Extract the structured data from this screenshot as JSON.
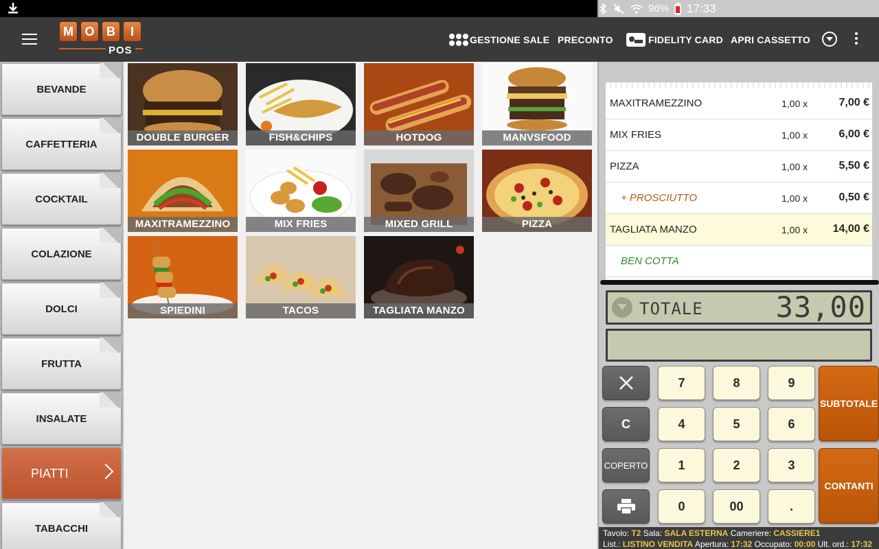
{
  "statusbar": {
    "battery": "96%",
    "time": "17:33"
  },
  "appbar": {
    "logo_letters": [
      "M",
      "O",
      "B",
      "I"
    ],
    "logo_sub": "POS",
    "actions": {
      "gestione_sale": "GESTIONE SALE",
      "preconto": "PRECONTO",
      "fidelity_card": "FIDELITY CARD",
      "apri_cassetto": "APRI CASSETTO"
    }
  },
  "categories": [
    {
      "label": "BEVANDE"
    },
    {
      "label": "CAFFETTERIA"
    },
    {
      "label": "COCKTAIL"
    },
    {
      "label": "COLAZIONE"
    },
    {
      "label": "DOLCI"
    },
    {
      "label": "FRUTTA"
    },
    {
      "label": "INSALATE"
    },
    {
      "label": "PIATTI",
      "active": true
    },
    {
      "label": "TABACCHI"
    }
  ],
  "products": [
    {
      "label": "DOUBLE BURGER",
      "color": "#6e4a2c"
    },
    {
      "label": "FISH&CHIPS",
      "color": "#c49a4c"
    },
    {
      "label": "HOTDOG",
      "color": "#c5541c"
    },
    {
      "label": "MANVSFOOD",
      "color": "#8d5b2e"
    },
    {
      "label": "MAXITRAMEZZINO",
      "color": "#b6721e"
    },
    {
      "label": "MIX FRIES",
      "color": "#d9a94a"
    },
    {
      "label": "MIXED GRILL",
      "color": "#5a4030"
    },
    {
      "label": "PIZZA",
      "color": "#b4502a"
    },
    {
      "label": "SPIEDINI",
      "color": "#c8651c"
    },
    {
      "label": "TACOS",
      "color": "#b3682e"
    },
    {
      "label": "TAGLIATA MANZO",
      "color": "#3c2a22"
    }
  ],
  "receipt": {
    "rows": [
      {
        "name": "MAXITRAMEZZINO",
        "qty": "1,00 x",
        "price": "7,00 €"
      },
      {
        "name": "MIX FRIES",
        "qty": "1,00 x",
        "price": "6,00 €"
      },
      {
        "name": "PIZZA",
        "qty": "1,00 x",
        "price": "5,50 €"
      },
      {
        "name": "+ PROSCIUTTO",
        "qty": "1,00 x",
        "price": "0,50 €",
        "kind": "mod"
      },
      {
        "name": "TAGLIATA MANZO",
        "qty": "1,00 x",
        "price": "14,00 €",
        "selected": true
      },
      {
        "name": "BEN COTTA",
        "qty": "",
        "price": "",
        "kind": "note"
      }
    ]
  },
  "total": {
    "label": "TOTALE",
    "amount": "33,00"
  },
  "keypad": {
    "clear": "C",
    "coperto": "COPERTO",
    "digits": [
      "7",
      "8",
      "9",
      "4",
      "5",
      "6",
      "1",
      "2",
      "3",
      "0",
      "00",
      "."
    ],
    "subtotale": "SUBTOTALE",
    "contanti": "CONTANTI"
  },
  "info": {
    "tavolo_label": "Tavolo:",
    "tavolo": "T2",
    "sala_label": "Sala:",
    "sala": "SALA ESTERNA",
    "cameriere_label": "Cameriere:",
    "cameriere": "CASSIERE1",
    "listino_label": "List.:",
    "listino": "LISTINO VENDITA",
    "apertura_label": "Apertura:",
    "apertura": "17:32",
    "occupato_label": "Occupato:",
    "occupato": "00:00",
    "ult_label": "Ult. ord.:",
    "ult": "17:32"
  }
}
